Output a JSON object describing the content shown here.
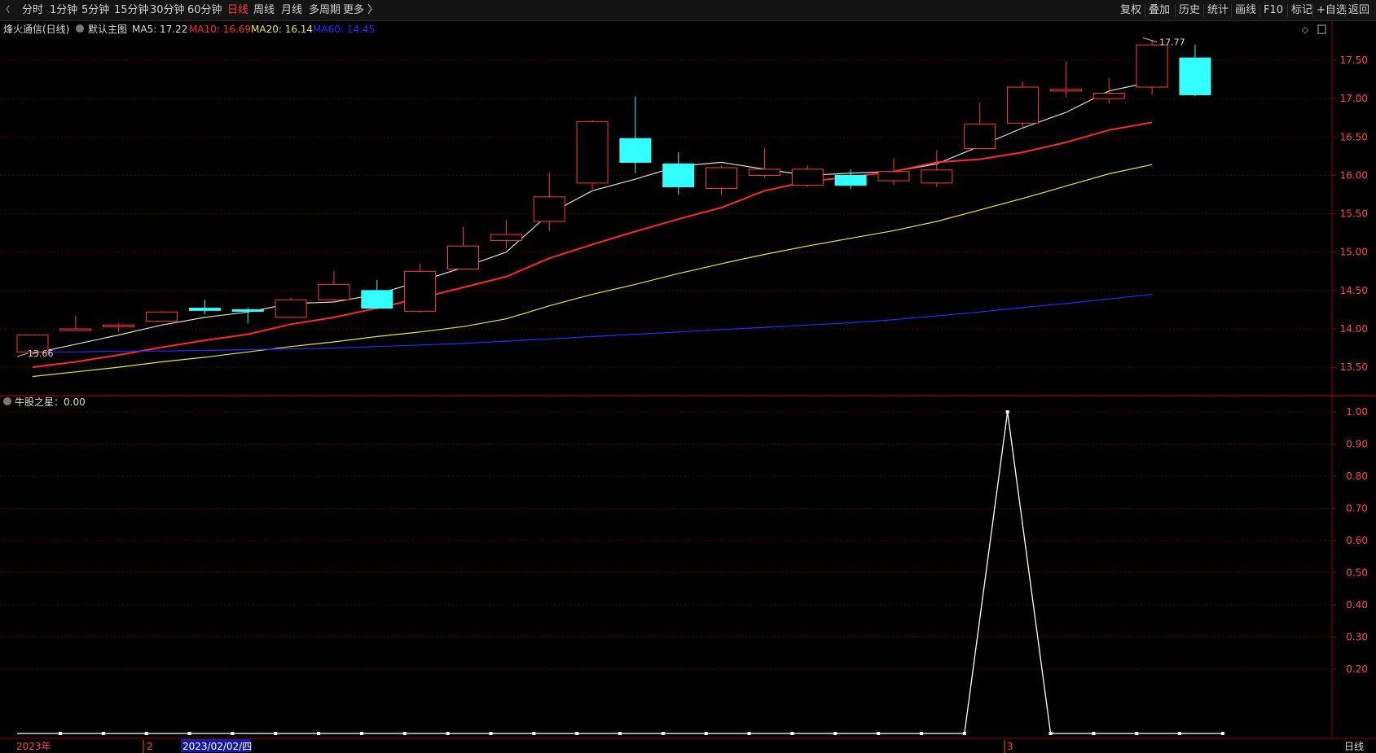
{
  "toolbar": {
    "periods": [
      {
        "label": "分时",
        "active": false
      },
      {
        "label": "1分钟",
        "active": false
      },
      {
        "label": "5分钟",
        "active": false
      },
      {
        "label": "15分钟",
        "active": false
      },
      {
        "label": "30分钟",
        "active": false
      },
      {
        "label": "60分钟",
        "active": false
      },
      {
        "label": "日线",
        "active": true
      },
      {
        "label": "周线",
        "active": false
      },
      {
        "label": "月线",
        "active": false
      },
      {
        "label": "多周期",
        "active": false
      },
      {
        "label": "更多 〉",
        "active": false
      }
    ],
    "right_buttons": [
      "复权",
      "叠加",
      "历史",
      "统计",
      "画线",
      "F10",
      "标记",
      "+自选",
      "返回"
    ]
  },
  "main_panel": {
    "title": "烽火通信(日线)",
    "indicator_name": "默认主图",
    "ma": [
      {
        "label": "MA5: 17.22",
        "color": "#dcdcdc"
      },
      {
        "label": "MA10: 16.69",
        "color": "#ff2a2a"
      },
      {
        "label": "MA20: 16.14",
        "color": "#e6e632"
      },
      {
        "label": "MA60: 14.45",
        "color": "#2a2aff"
      }
    ],
    "high_marker": "17.77",
    "low_marker": "13.66"
  },
  "sub_panel": {
    "title": "牛股之星：0.00"
  },
  "bottom": {
    "labels": [
      "2023年",
      "2",
      "2023/02/02/四",
      "3"
    ],
    "period": "日线"
  },
  "colors": {
    "up": "#ff3c3c",
    "down": "#33ffff",
    "grid": "#5a0000",
    "ma5": "#dcdcdc",
    "ma10": "#ff2a2a",
    "ma20": "#e6e632",
    "ma60": "#2a2aff",
    "signal": "#ffffff"
  },
  "chart_data": [
    {
      "type": "candlestick",
      "title": "烽火通信(日线)",
      "ylim": [
        13.3,
        17.8
      ],
      "y_ticks": [
        13.5,
        14.0,
        14.5,
        15.0,
        15.5,
        16.0,
        16.5,
        17.0,
        17.5
      ],
      "y_tick_labels": [
        "13.50",
        "14.00",
        "14.50",
        "15.00",
        "15.50",
        "16.00",
        "16.50",
        "17.00",
        "17.50"
      ],
      "candles": [
        {
          "o": 13.7,
          "h": 13.92,
          "l": 13.66,
          "c": 13.92
        },
        {
          "o": 14.0,
          "h": 14.17,
          "l": 13.98,
          "c": 14.0
        },
        {
          "o": 14.05,
          "h": 14.07,
          "l": 13.96,
          "c": 14.05
        },
        {
          "o": 14.1,
          "h": 14.23,
          "l": 14.1,
          "c": 14.22
        },
        {
          "o": 14.27,
          "h": 14.38,
          "l": 14.19,
          "c": 14.24
        },
        {
          "o": 14.25,
          "h": 14.28,
          "l": 14.07,
          "c": 14.23
        },
        {
          "o": 14.15,
          "h": 14.4,
          "l": 14.15,
          "c": 14.38
        },
        {
          "o": 14.38,
          "h": 14.75,
          "l": 14.35,
          "c": 14.58
        },
        {
          "o": 14.5,
          "h": 14.64,
          "l": 14.26,
          "c": 14.27
        },
        {
          "o": 14.23,
          "h": 14.85,
          "l": 14.21,
          "c": 14.75
        },
        {
          "o": 14.78,
          "h": 15.33,
          "l": 14.77,
          "c": 15.08
        },
        {
          "o": 15.15,
          "h": 15.42,
          "l": 15.05,
          "c": 15.23
        },
        {
          "o": 15.4,
          "h": 16.04,
          "l": 15.27,
          "c": 15.72
        },
        {
          "o": 15.9,
          "h": 16.72,
          "l": 15.82,
          "c": 16.7
        },
        {
          "o": 16.48,
          "h": 17.03,
          "l": 16.03,
          "c": 16.17
        },
        {
          "o": 16.15,
          "h": 16.3,
          "l": 15.75,
          "c": 15.85
        },
        {
          "o": 15.83,
          "h": 16.13,
          "l": 15.75,
          "c": 16.1
        },
        {
          "o": 16.0,
          "h": 16.35,
          "l": 15.97,
          "c": 16.08
        },
        {
          "o": 15.87,
          "h": 16.13,
          "l": 15.85,
          "c": 16.08
        },
        {
          "o": 16.0,
          "h": 16.08,
          "l": 15.82,
          "c": 15.87
        },
        {
          "o": 15.93,
          "h": 16.22,
          "l": 15.87,
          "c": 16.05
        },
        {
          "o": 15.9,
          "h": 16.33,
          "l": 15.85,
          "c": 16.07
        },
        {
          "o": 16.35,
          "h": 16.95,
          "l": 16.35,
          "c": 16.67
        },
        {
          "o": 16.68,
          "h": 17.22,
          "l": 16.62,
          "c": 17.15
        },
        {
          "o": 17.12,
          "h": 17.48,
          "l": 17.02,
          "c": 17.12
        },
        {
          "o": 17.0,
          "h": 17.27,
          "l": 16.93,
          "c": 17.07
        },
        {
          "o": 17.15,
          "h": 17.77,
          "l": 17.05,
          "c": 17.7
        },
        {
          "o": 17.53,
          "h": 17.7,
          "l": 17.03,
          "c": 17.05
        }
      ],
      "series": [
        {
          "name": "MA5",
          "values": [
            13.68,
            13.8,
            13.92,
            14.05,
            14.15,
            14.22,
            14.33,
            14.35,
            14.45,
            14.62,
            14.8,
            15.0,
            15.5,
            15.8,
            15.95,
            16.12,
            16.17,
            16.08,
            16.0,
            16.03,
            16.05,
            16.15,
            16.38,
            16.62,
            16.82,
            17.1,
            17.22
          ]
        },
        {
          "name": "MA10",
          "values": [
            13.5,
            13.57,
            13.66,
            13.76,
            13.85,
            13.93,
            14.06,
            14.15,
            14.27,
            14.4,
            14.54,
            14.68,
            14.92,
            15.1,
            15.27,
            15.43,
            15.58,
            15.8,
            15.92,
            15.98,
            16.05,
            16.17,
            16.21,
            16.3,
            16.43,
            16.59,
            16.69
          ]
        },
        {
          "name": "MA20",
          "values": [
            13.38,
            13.44,
            13.5,
            13.57,
            13.63,
            13.7,
            13.77,
            13.83,
            13.9,
            13.96,
            14.03,
            14.13,
            14.3,
            14.45,
            14.58,
            14.72,
            14.85,
            14.97,
            15.08,
            15.18,
            15.28,
            15.4,
            15.55,
            15.7,
            15.86,
            16.02,
            16.14
          ]
        },
        {
          "name": "MA60",
          "values": [
            13.7,
            13.7,
            13.71,
            13.71,
            13.72,
            13.73,
            13.74,
            13.75,
            13.77,
            13.79,
            13.81,
            13.84,
            13.87,
            13.9,
            13.93,
            13.96,
            13.99,
            14.02,
            14.05,
            14.08,
            14.12,
            14.17,
            14.22,
            14.28,
            14.33,
            14.39,
            14.45
          ]
        }
      ]
    },
    {
      "type": "line",
      "title": "牛股之星",
      "ylim": [
        0,
        1.05
      ],
      "y_ticks": [
        0.2,
        0.3,
        0.4,
        0.5,
        0.6,
        0.7,
        0.8,
        0.9,
        1.0
      ],
      "y_tick_labels": [
        "0.20",
        "0.30",
        "0.40",
        "0.50",
        "0.60",
        "0.70",
        "0.80",
        "0.90",
        "1.00"
      ],
      "series": [
        {
          "name": "牛股之星",
          "values": [
            0,
            0,
            0,
            0,
            0,
            0,
            0,
            0,
            0,
            0,
            0,
            0,
            0,
            0,
            0,
            0,
            0,
            0,
            0,
            0,
            0,
            0,
            1,
            0,
            0,
            0,
            0,
            0
          ]
        }
      ]
    }
  ]
}
